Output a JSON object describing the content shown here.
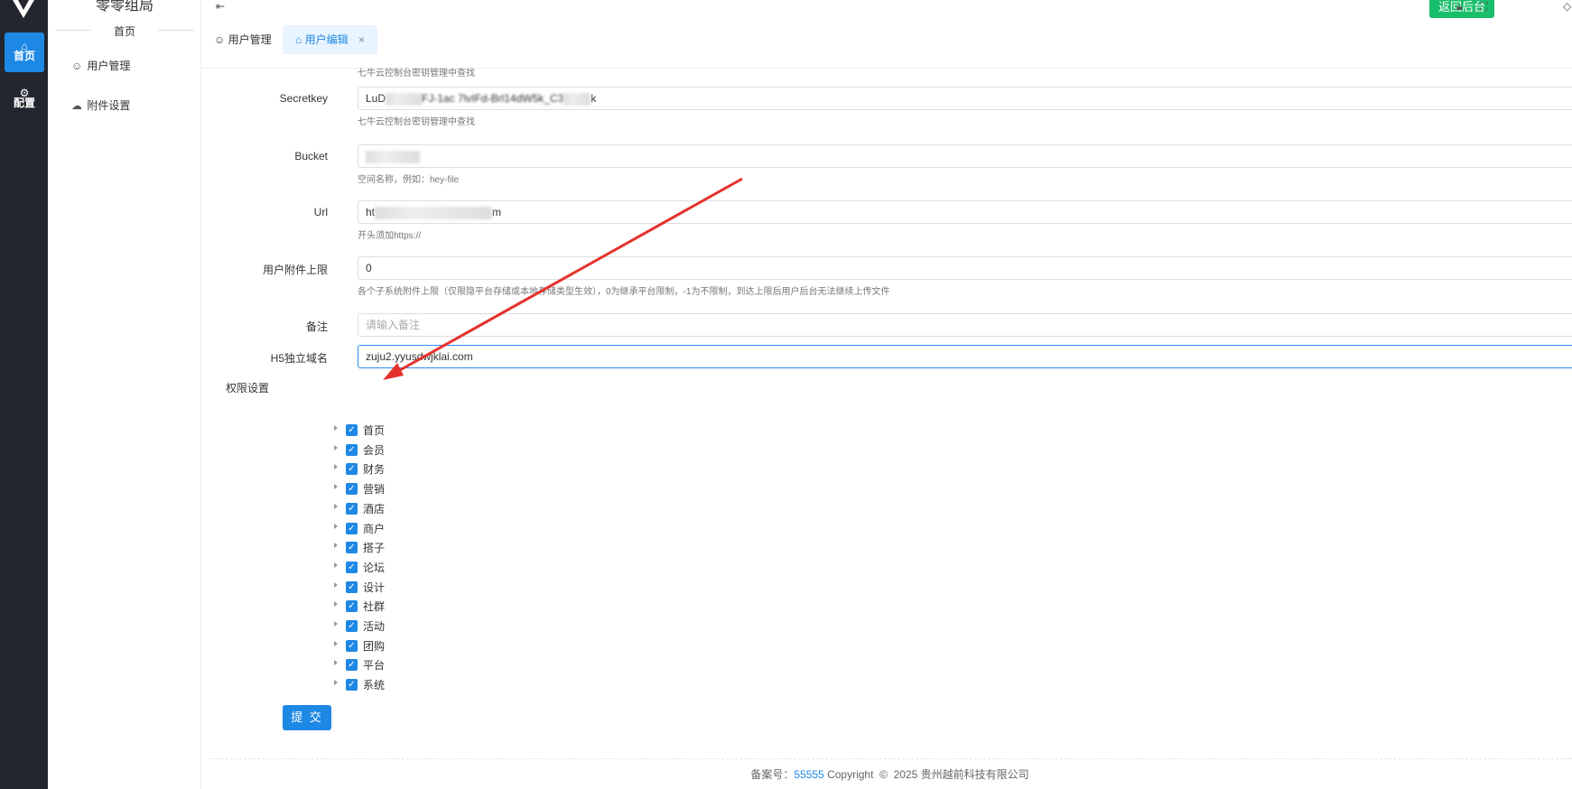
{
  "rail": {
    "items": [
      {
        "label": "首页",
        "icon": "home-icon"
      },
      {
        "label": "配置",
        "icon": "settings-icon"
      }
    ]
  },
  "sidebar": {
    "brand": "零零组局",
    "crumb": "首页",
    "items": [
      {
        "label": "用户管理",
        "icon": "user-icon"
      },
      {
        "label": "附件设置",
        "icon": "cloud-upload-icon"
      }
    ]
  },
  "header": {
    "back_label": "返回后台"
  },
  "tabs": [
    {
      "label": "用户管理",
      "icon": "user-icon"
    },
    {
      "label": "用户编辑",
      "icon": "home-icon",
      "close": "×"
    }
  ],
  "form": {
    "top_hint": "七牛云控制台密钥管理中查找",
    "fields": [
      {
        "label": "Secretkey",
        "value_prefix": "LuD",
        "value_mid": "FJ-1ac 7lvIFd-Brl14dW5k_C3",
        "value_suffix": "k",
        "hint": "七牛云控制台密钥管理中查找"
      },
      {
        "label": "Bucket",
        "value_prefix": "",
        "value_mid": "",
        "value_suffix": "",
        "hint": "空间名称，例如：hey-file"
      },
      {
        "label": "Url",
        "value_prefix": "ht",
        "value_mid": "",
        "value_suffix": "m",
        "hint": "开头须加https://"
      },
      {
        "label": "用户附件上限",
        "value": "0",
        "hint": "各个子系统附件上限（仅限隐平台存储或本地存储类型生效），0为继承平台限制，-1为不限制，到达上限后用户后台无法继续上传文件"
      },
      {
        "label": "备注",
        "placeholder": "请输入备注"
      },
      {
        "label": "H5独立域名",
        "value": "zuju2.yyusdwjklai.com"
      }
    ],
    "perm_label": "权限设置",
    "permissions": [
      "首页",
      "会员",
      "财务",
      "营销",
      "酒店",
      "商户",
      "搭子",
      "论坛",
      "设计",
      "社群",
      "活动",
      "团购",
      "平台",
      "系统"
    ],
    "check": "✓",
    "submit_label": "提 交"
  },
  "footer": {
    "prefix": "备案号：",
    "number": "55555",
    "copyright": "Copyright",
    "symbol": "©",
    "year_company": "2025 贵州越前科技有限公司"
  },
  "colors": {
    "primary": "#1e88e5",
    "success": "#19be6b",
    "annotation": "#e5312b",
    "rail": "#23262e"
  }
}
